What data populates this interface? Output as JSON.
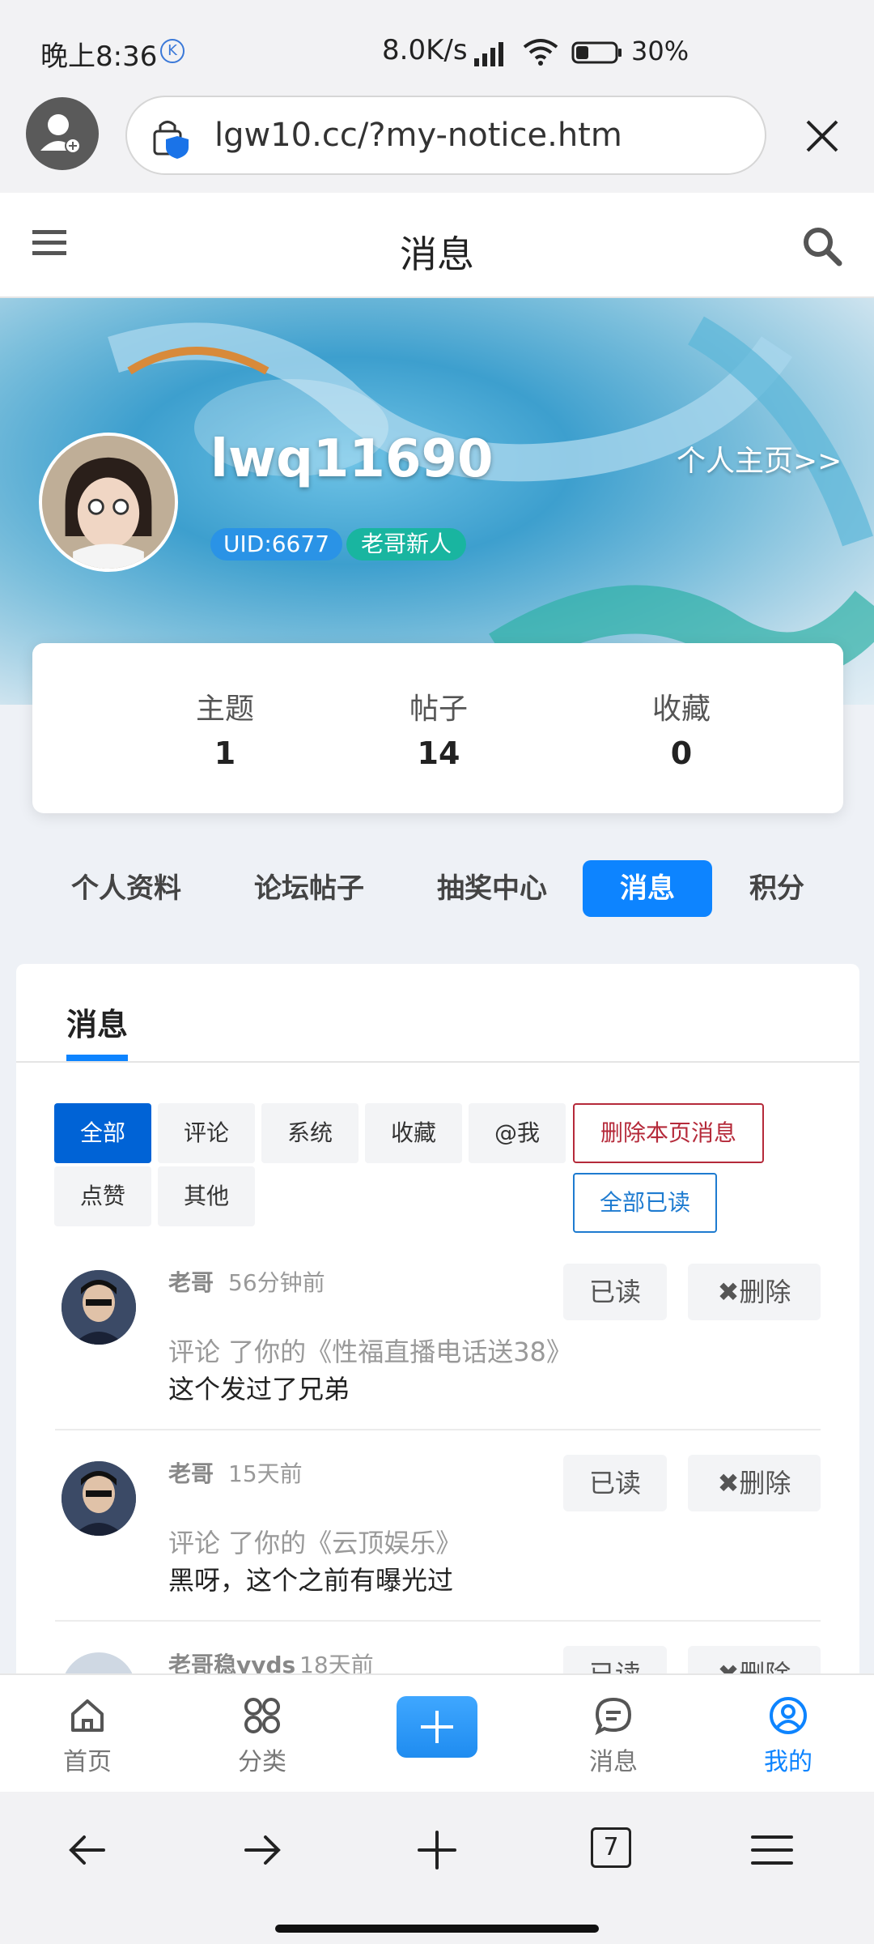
{
  "status_bar": {
    "time": "晚上8:36",
    "network_speed": "8.0K/s",
    "battery_percent": "30%"
  },
  "browser": {
    "url": "lgw10.cc/?my-notice.htm",
    "tab_count": "7"
  },
  "header": {
    "title": "消息"
  },
  "profile": {
    "username": "lwq11690",
    "homepage_link": "个人主页>>",
    "uid": "UID:6677",
    "rank": "老哥新人",
    "stats": [
      {
        "label": "主题",
        "value": "1"
      },
      {
        "label": "帖子",
        "value": "14"
      },
      {
        "label": "收藏",
        "value": "0"
      }
    ]
  },
  "profile_tabs": [
    "个人资料",
    "论坛帖子",
    "抽奖中心",
    "消息",
    "积分"
  ],
  "active_profile_tab": "消息",
  "messages_panel": {
    "tab_label": "消息",
    "filters": [
      "全部",
      "评论",
      "系统",
      "收藏",
      "@我",
      "点赞",
      "其他"
    ],
    "active_filter": "全部",
    "delete_page_label": "删除本页消息",
    "mark_all_read_label": "全部已读",
    "items": [
      {
        "author": "老哥",
        "time": "56分钟前",
        "type": "评论 了你的",
        "title": "《性福直播电话送38》",
        "body": "这个发过了兄弟",
        "read_label": "已读",
        "delete_label": "删除"
      },
      {
        "author": "老哥",
        "time": "15天前",
        "type": "评论 了你的",
        "title": "《云顶娱乐》",
        "body": "黑呀，这个之前有曝光过",
        "read_label": "已读",
        "delete_label": "删除"
      },
      {
        "author": "老哥稳yyds",
        "time": "18天前",
        "read_label": "已读",
        "delete_label": "删除"
      }
    ]
  },
  "bottom_nav": {
    "items": [
      "首页",
      "分类",
      "消息",
      "我的"
    ],
    "active": "我的"
  },
  "colors": {
    "accent": "#0d84ff",
    "danger": "#b52a3a",
    "uid_badge": "#2a93e6",
    "rank_badge": "#19b5a0"
  }
}
